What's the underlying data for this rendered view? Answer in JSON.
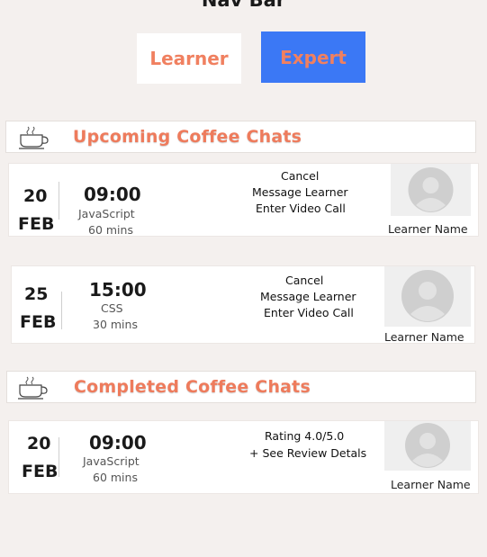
{
  "nav": {
    "title": "Nav Bar"
  },
  "toggle": {
    "learner_label": "Learner",
    "expert_label": "Expert"
  },
  "sections": {
    "upcoming_title": "Upcoming Coffee Chats",
    "completed_title": "Completed Coffee Chats"
  },
  "upcoming": [
    {
      "day": "20",
      "month": "FEB",
      "time": "09:00",
      "topic": "JavaScript",
      "duration": "60 mins",
      "actions": [
        "Cancel",
        "Message Learner",
        "Enter Video Call"
      ],
      "learner_name": "Learner Name"
    },
    {
      "day": "25",
      "month": "FEB",
      "time": "15:00",
      "topic": "CSS",
      "duration": "30 mins",
      "actions": [
        "Cancel",
        "Message Learner",
        "Enter Video Call"
      ],
      "learner_name": "Learner Name"
    }
  ],
  "completed": [
    {
      "day": "20",
      "month": "FEB",
      "time": "09:00",
      "topic": "JavaScript",
      "duration": "60 mins",
      "rating": "Rating 4.0/5.0",
      "review_link": "+ See Review Detals",
      "learner_name": "Learner Name"
    }
  ],
  "colors": {
    "accent_orange": "#ee7b5c",
    "expert_blue": "#3b78f5",
    "background": "#f4f0ee"
  },
  "icons": {
    "section_icon": "coffee-cup-icon",
    "avatar_icon": "user-avatar-icon"
  }
}
